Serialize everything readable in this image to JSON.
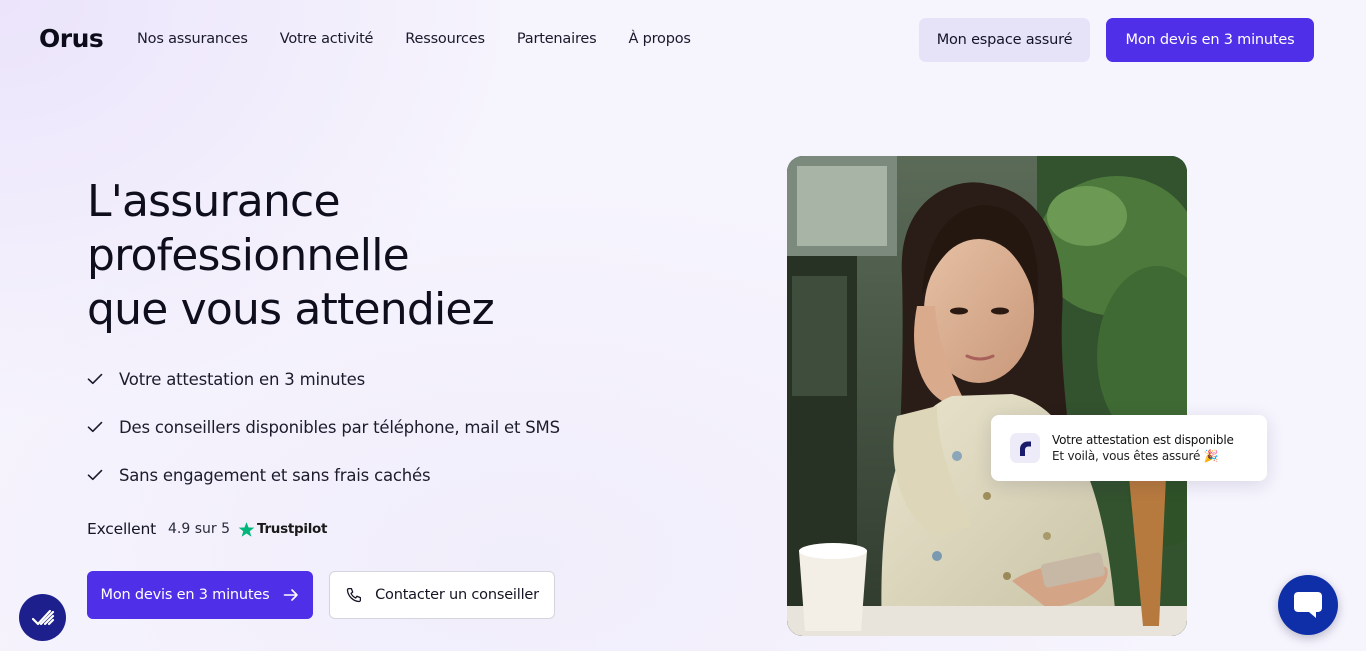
{
  "header": {
    "logo": "Orus",
    "nav": [
      "Nos assurances",
      "Votre activité",
      "Ressources",
      "Partenaires",
      "À propos"
    ],
    "account_button": "Mon espace assuré",
    "quote_button": "Mon devis en 3 minutes"
  },
  "hero": {
    "title_lines": [
      "L'assurance",
      "professionnelle",
      "que vous attendiez"
    ],
    "benefits": [
      "Votre attestation en 3 minutes",
      "Des conseillers disponibles par téléphone, mail et SMS",
      "Sans engagement et sans frais cachés"
    ],
    "rating": {
      "label": "Excellent",
      "score": "4.9 sur 5",
      "provider": "Trustpilot"
    },
    "cta_primary": "Mon devis en 3 minutes",
    "cta_secondary": "Contacter un conseiller"
  },
  "notification": {
    "title": "Votre attestation est disponible",
    "subtitle": "Et voilà, vous êtes assuré 🎉"
  },
  "colors": {
    "brand": "#4f2fe8",
    "accent_light": "#e6e3f9",
    "trustpilot": "#00b67a",
    "chat": "#0f2fa8"
  },
  "icons": {
    "check": "check-icon",
    "arrow": "arrow-right-icon",
    "phone": "phone-icon",
    "star": "star-icon",
    "chat": "chat-icon",
    "accessibility": "accessibility-icon"
  }
}
